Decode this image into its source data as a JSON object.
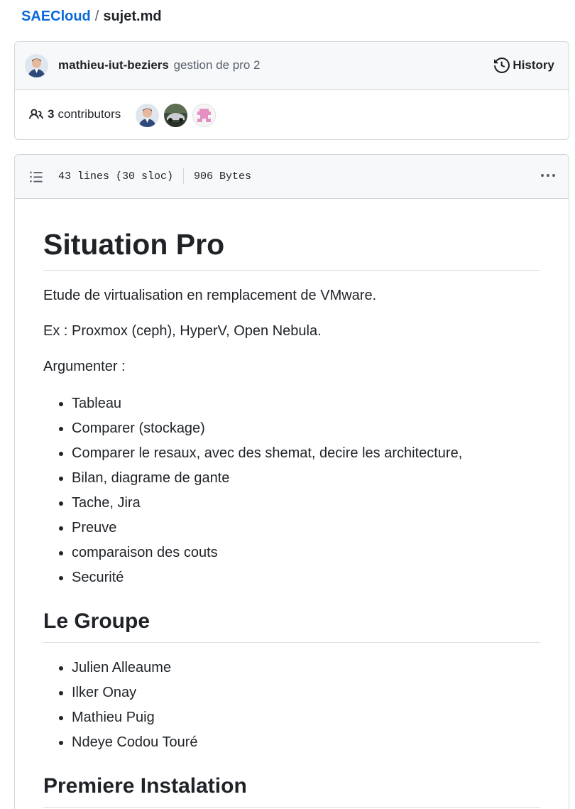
{
  "breadcrumb": {
    "repo": "SAECloud",
    "separator": "/",
    "file": "sujet.md"
  },
  "commit": {
    "author": "mathieu-iut-beziers",
    "message": "gestion de pro 2",
    "history_label": "History"
  },
  "contributors": {
    "count": "3",
    "label": "contributors"
  },
  "file_header": {
    "lines": "43 lines (30 sloc)",
    "size": "906 Bytes"
  },
  "content": {
    "title": "Situation Pro",
    "intro": "Etude de virtualisation en remplacement de VMware.",
    "examples": "Ex : Proxmox (ceph), HyperV, Open Nebula.",
    "argument_label": "Argumenter :",
    "arguments": [
      "Tableau",
      "Comparer (stockage)",
      "Comparer le resaux, avec des shemat, decire les architecture,",
      "Bilan, diagrame de gante",
      "Tache, Jira",
      "Preuve",
      "comparaison des couts",
      "Securité"
    ],
    "group_heading": "Le Groupe",
    "group": [
      "Julien Alleaume",
      "Ilker Onay",
      "Mathieu Puig",
      "Ndeye Codou Touré"
    ],
    "install_heading": "Premiere Instalation"
  },
  "colors": {
    "link": "#0969da",
    "text": "#1f2328",
    "muted": "#57606a",
    "border": "#d0d7de",
    "header_bg": "#f6f8fa"
  },
  "icons": {
    "history": "history-icon",
    "people": "people-icon",
    "toc": "list-unordered-icon",
    "more": "kebab-horizontal-icon"
  }
}
